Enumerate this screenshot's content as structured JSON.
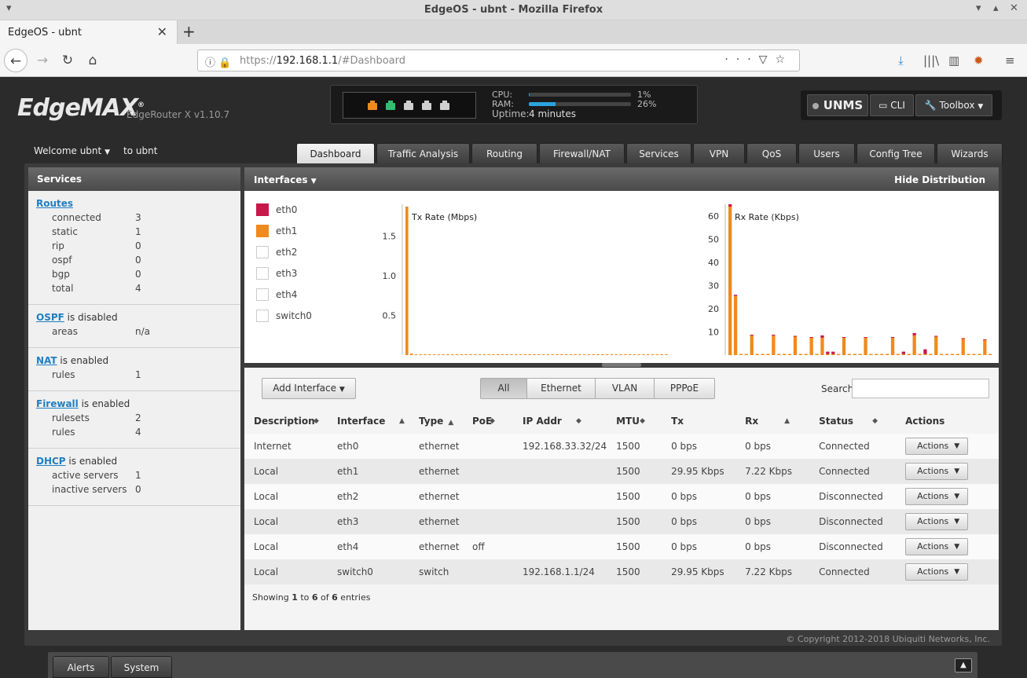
{
  "browser": {
    "window_title": "EdgeOS - ubnt - Mozilla Firefox",
    "tab_title": "EdgeOS - ubnt",
    "url_prefix": "https://",
    "url_host": "192.168.1.1",
    "url_path": "/#Dashboard"
  },
  "header": {
    "logo": "EdgeMAX",
    "model": "EdgeRouter X v1.10.7",
    "cpu_label": "CPU:",
    "cpu_value": "1%",
    "cpu_fraction": 0.01,
    "ram_label": "RAM:",
    "ram_value": "26%",
    "ram_fraction": 0.26,
    "uptime_label": "Uptime:",
    "uptime_value": "4 minutes",
    "unms_label": "UNMS",
    "cli_label": "CLI",
    "toolbox_label": "Toolbox",
    "welcome": "Welcome ubnt",
    "to_label": "to ubnt",
    "port_colors": [
      "#f08a1c",
      "#2fbf71",
      "#cfcfcf",
      "#cfcfcf",
      "#cfcfcf"
    ]
  },
  "tabs": [
    "Dashboard",
    "Traffic Analysis",
    "Routing",
    "Firewall/NAT",
    "Services",
    "VPN",
    "QoS",
    "Users",
    "Config Tree",
    "Wizards"
  ],
  "services": {
    "title": "Services",
    "routes": {
      "link": "Routes",
      "rows": [
        {
          "k": "connected",
          "v": "3"
        },
        {
          "k": "static",
          "v": "1"
        },
        {
          "k": "rip",
          "v": "0"
        },
        {
          "k": "ospf",
          "v": "0"
        },
        {
          "k": "bgp",
          "v": "0"
        },
        {
          "k": "total",
          "v": "4"
        }
      ]
    },
    "ospf": {
      "link": "OSPF",
      "state": " is disabled",
      "rows": [
        {
          "k": "areas",
          "v": "n/a"
        }
      ]
    },
    "nat": {
      "link": "NAT",
      "state": " is enabled",
      "rows": [
        {
          "k": "rules",
          "v": "1"
        }
      ]
    },
    "firewall": {
      "link": "Firewall",
      "state": " is enabled",
      "rows": [
        {
          "k": "rulesets",
          "v": "2"
        },
        {
          "k": "rules",
          "v": "4"
        }
      ]
    },
    "dhcp": {
      "link": "DHCP",
      "state": " is enabled",
      "rows": [
        {
          "k": "active servers",
          "v": "1"
        },
        {
          "k": "inactive servers",
          "v": "0"
        }
      ]
    }
  },
  "interfaces_panel": {
    "title": "Interfaces",
    "hide_label": "Hide Distribution",
    "legend": [
      {
        "name": "eth0",
        "color": "#c8174a"
      },
      {
        "name": "eth1",
        "color": "#f08a1c"
      },
      {
        "name": "eth2",
        "color": ""
      },
      {
        "name": "eth3",
        "color": ""
      },
      {
        "name": "eth4",
        "color": ""
      },
      {
        "name": "switch0",
        "color": ""
      }
    ]
  },
  "chart_data": [
    {
      "type": "bar",
      "title": "Tx Rate (Mbps)",
      "ylim": [
        0,
        1.9
      ],
      "yticks": [
        "0.5",
        "1.0",
        "1.5"
      ],
      "series": [
        {
          "name": "eth1",
          "values": [
            1.87,
            0.02,
            0.01,
            0.01,
            0.01,
            0.01,
            0.01,
            0.01,
            0.01,
            0.01,
            0.01,
            0.01,
            0.01,
            0.01,
            0.01,
            0.01,
            0.01,
            0.01,
            0.01,
            0.01,
            0.01,
            0.01,
            0.01,
            0.01,
            0.01,
            0.01,
            0.01,
            0.01,
            0.01,
            0.01,
            0.01,
            0.01,
            0.01,
            0.01,
            0.01,
            0.01,
            0.01,
            0.01,
            0.01,
            0.01,
            0.01,
            0.01,
            0.01,
            0.01,
            0.01,
            0.01,
            0.01,
            0.01,
            0.01,
            0.01,
            0.01,
            0.01,
            0.01,
            0.01,
            0.01,
            0.01,
            0.01,
            0.01
          ]
        }
      ]
    },
    {
      "type": "bar",
      "title": "Rx Rate (Kbps)",
      "ylim": [
        0,
        65
      ],
      "yticks": [
        "10",
        "20",
        "30",
        "40",
        "50",
        "60"
      ],
      "series": [
        {
          "name": "eth1",
          "values": [
            64,
            25.5,
            0.5,
            0.5,
            8.5,
            0.5,
            0.5,
            0.5,
            8.5,
            0.5,
            0.5,
            0.5,
            8,
            0.5,
            0.5,
            7.5,
            0.5,
            7.5,
            0.5,
            0.5,
            0.5,
            7.5,
            0.5,
            0.5,
            0.5,
            7.5,
            0.5,
            0.5,
            0.5,
            0.5,
            7.5,
            0.5,
            0.5,
            0.5,
            8.5,
            0.5,
            0.5,
            0.5,
            8,
            0.5,
            0.5,
            0.5,
            0.5,
            7,
            0.5,
            0.5,
            0.5,
            6.5,
            0.5
          ]
        },
        {
          "name": "eth0",
          "values": [
            1,
            0.5,
            0,
            0,
            0.3,
            0,
            0,
            0,
            0.3,
            0,
            0,
            0,
            0.3,
            0,
            0,
            0.3,
            0,
            1,
            1,
            1,
            0,
            0.3,
            0,
            0,
            0,
            0.3,
            0,
            0,
            0,
            0,
            0.3,
            0,
            1,
            0,
            1,
            0,
            2,
            0,
            0.3,
            0,
            0,
            0,
            0,
            0.3,
            0,
            0,
            0,
            0.3,
            0
          ]
        }
      ]
    }
  ],
  "toolbar": {
    "add_interface": "Add Interface",
    "filters": [
      "All",
      "Ethernet",
      "VLAN",
      "PPPoE"
    ],
    "search_label": "Search",
    "search_value": ""
  },
  "table": {
    "headers": [
      "Description",
      "Interface",
      "Type",
      "PoE",
      "IP Addr",
      "MTU",
      "Tx",
      "Rx",
      "Status",
      "Actions"
    ],
    "rows": [
      {
        "description": "Internet",
        "interface": "eth0",
        "type": "ethernet",
        "poe": "",
        "ip": "192.168.33.32/24",
        "mtu": "1500",
        "tx": "0 bps",
        "rx": "0 bps",
        "status": "Connected",
        "action": "Actions"
      },
      {
        "description": "Local",
        "interface": "eth1",
        "type": "ethernet",
        "poe": "",
        "ip": "",
        "mtu": "1500",
        "tx": "29.95 Kbps",
        "rx": "7.22 Kbps",
        "status": "Connected",
        "action": "Actions"
      },
      {
        "description": "Local",
        "interface": "eth2",
        "type": "ethernet",
        "poe": "",
        "ip": "",
        "mtu": "1500",
        "tx": "0 bps",
        "rx": "0 bps",
        "status": "Disconnected",
        "action": "Actions"
      },
      {
        "description": "Local",
        "interface": "eth3",
        "type": "ethernet",
        "poe": "",
        "ip": "",
        "mtu": "1500",
        "tx": "0 bps",
        "rx": "0 bps",
        "status": "Disconnected",
        "action": "Actions"
      },
      {
        "description": "Local",
        "interface": "eth4",
        "type": "ethernet",
        "poe": "off",
        "ip": "",
        "mtu": "1500",
        "tx": "0 bps",
        "rx": "0 bps",
        "status": "Disconnected",
        "action": "Actions"
      },
      {
        "description": "Local",
        "interface": "switch0",
        "type": "switch",
        "poe": "",
        "ip": "192.168.1.1/24",
        "mtu": "1500",
        "tx": "29.95 Kbps",
        "rx": "7.22 Kbps",
        "status": "Connected",
        "action": "Actions"
      }
    ],
    "showing_pre": "Showing ",
    "showing_from": "1",
    "showing_mid": " to ",
    "showing_to": "6",
    "showing_of": " of ",
    "showing_total": "6",
    "showing_post": " entries"
  },
  "footer": {
    "copyright": "© Copyright 2012-2018 Ubiquiti Networks, Inc.",
    "alerts": "Alerts",
    "system": "System"
  }
}
